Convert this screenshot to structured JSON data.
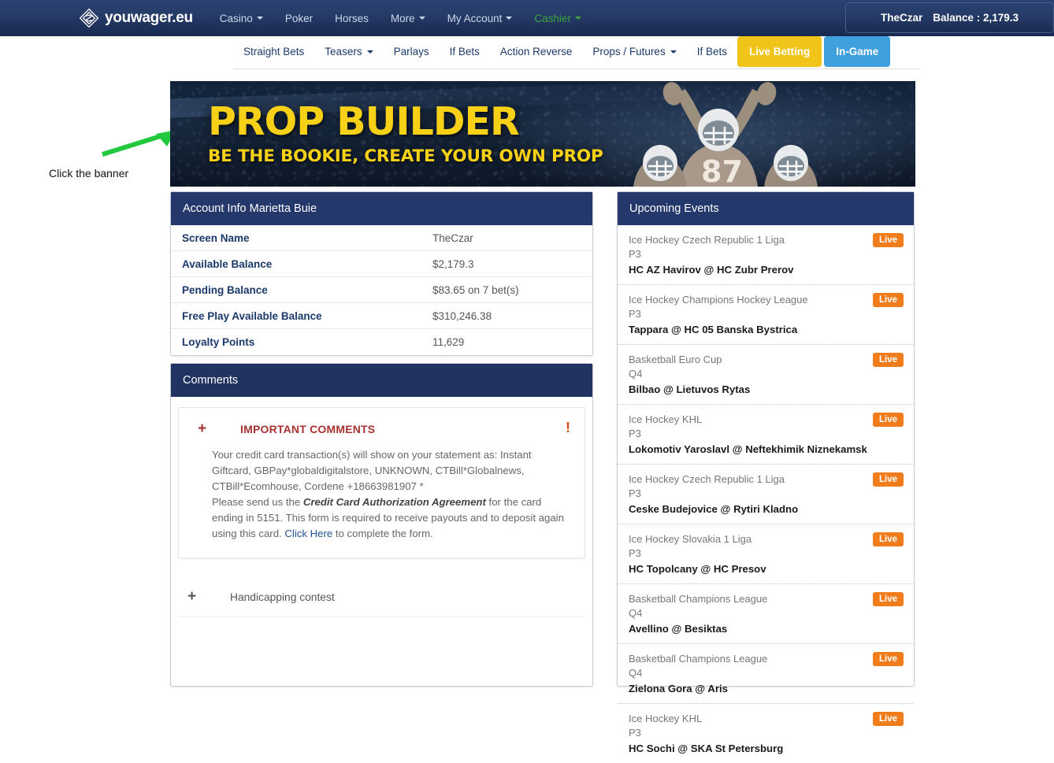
{
  "header": {
    "brand": "youwager.eu",
    "brand_icon": "diamond-logo-icon",
    "nav": [
      {
        "label": "Casino",
        "caret": true,
        "accent": false
      },
      {
        "label": "Poker",
        "caret": false,
        "accent": false
      },
      {
        "label": "Horses",
        "caret": false,
        "accent": false
      },
      {
        "label": "More",
        "caret": true,
        "accent": false
      },
      {
        "label": "My Account",
        "caret": true,
        "accent": false
      },
      {
        "label": "Cashier",
        "caret": true,
        "accent": true
      }
    ],
    "account_name": "TheCzar",
    "balance_label": "Balance : 2,179.3"
  },
  "subnav": {
    "items": [
      {
        "label": "Straight Bets",
        "caret": false
      },
      {
        "label": "Teasers",
        "caret": true
      },
      {
        "label": "Parlays",
        "caret": false
      },
      {
        "label": "If Bets",
        "caret": false
      },
      {
        "label": "Action Reverse",
        "caret": false
      },
      {
        "label": "Props / Futures",
        "caret": true
      },
      {
        "label": "If Bets",
        "caret": false
      }
    ],
    "live_betting": "Live Betting",
    "in_game": "In-Game",
    "live_betting_color": "#f0c419",
    "in_game_color": "#3ea0dd"
  },
  "annotation": {
    "text": "Click the banner",
    "arrow_color": "#22c93f"
  },
  "banner": {
    "title": "PROP BUILDER",
    "subtitle": "BE THE BOOKIE, CREATE YOUR OWN PROP",
    "title_color": "#f7d117"
  },
  "account": {
    "title": "Account Info Marietta Buie",
    "rows": [
      {
        "label": "Screen Name",
        "value": "TheCzar"
      },
      {
        "label": "Available Balance",
        "value": "$2,179.3"
      },
      {
        "label": "Pending Balance",
        "value": "$83.65 on 7 bet(s)"
      },
      {
        "label": "Free Play Available Balance",
        "value": "$310,246.38"
      },
      {
        "label": "Loyalty Points",
        "value": "11,629"
      }
    ]
  },
  "comments": {
    "title": "Comments",
    "plus_icon": "plus-icon",
    "bang_icon": "exclamation-icon",
    "important_title": "IMPORTANT COMMENTS",
    "para1": "Your credit card transaction(s) will show on your statement as: Instant Giftcard, GBPay*globaldigitalstore, UNKNOWN, CTBill*Globalnews, CTBill*Ecomhouse, Cordene +18663981907 *",
    "para2_pre": "Please send us the ",
    "para2_em": "Credit Card Authorization Agreement",
    "para2_mid": " for the card ending in 5151. This form is required to receive payouts and to deposit again using this card. ",
    "para2_link": "Click Here",
    "para2_post": " to complete the form.",
    "collapse_label": "Handicapping contest"
  },
  "events": {
    "title": "Upcoming Events",
    "badge_label": "Live",
    "badge_color": "#f07c1b",
    "items": [
      {
        "league": "Ice Hockey Czech Republic 1 Liga",
        "period": "P3",
        "match": "HC AZ Havirov @ HC Zubr Prerov"
      },
      {
        "league": "Ice Hockey Champions Hockey League",
        "period": "P3",
        "match": "Tappara @ HC 05 Banska Bystrica"
      },
      {
        "league": "Basketball Euro Cup",
        "period": "Q4",
        "match": "Bilbao @ Lietuvos Rytas"
      },
      {
        "league": "Ice Hockey KHL",
        "period": "P3",
        "match": "Lokomotiv Yaroslavl @ Neftekhimik Niznekamsk"
      },
      {
        "league": "Ice Hockey Czech Republic 1 Liga",
        "period": "P3",
        "match": "Ceske Budejovice @ Rytiri Kladno"
      },
      {
        "league": "Ice Hockey Slovakia 1 Liga",
        "period": "P3",
        "match": "HC Topolcany @ HC Presov"
      },
      {
        "league": "Basketball Champions League",
        "period": "Q4",
        "match": "Avellino @ Besiktas"
      },
      {
        "league": "Basketball Champions League",
        "period": "Q4",
        "match": "Zielona Gora @ Aris"
      },
      {
        "league": "Ice Hockey KHL",
        "period": "P3",
        "match": "HC Sochi @ SKA St Petersburg"
      }
    ]
  }
}
